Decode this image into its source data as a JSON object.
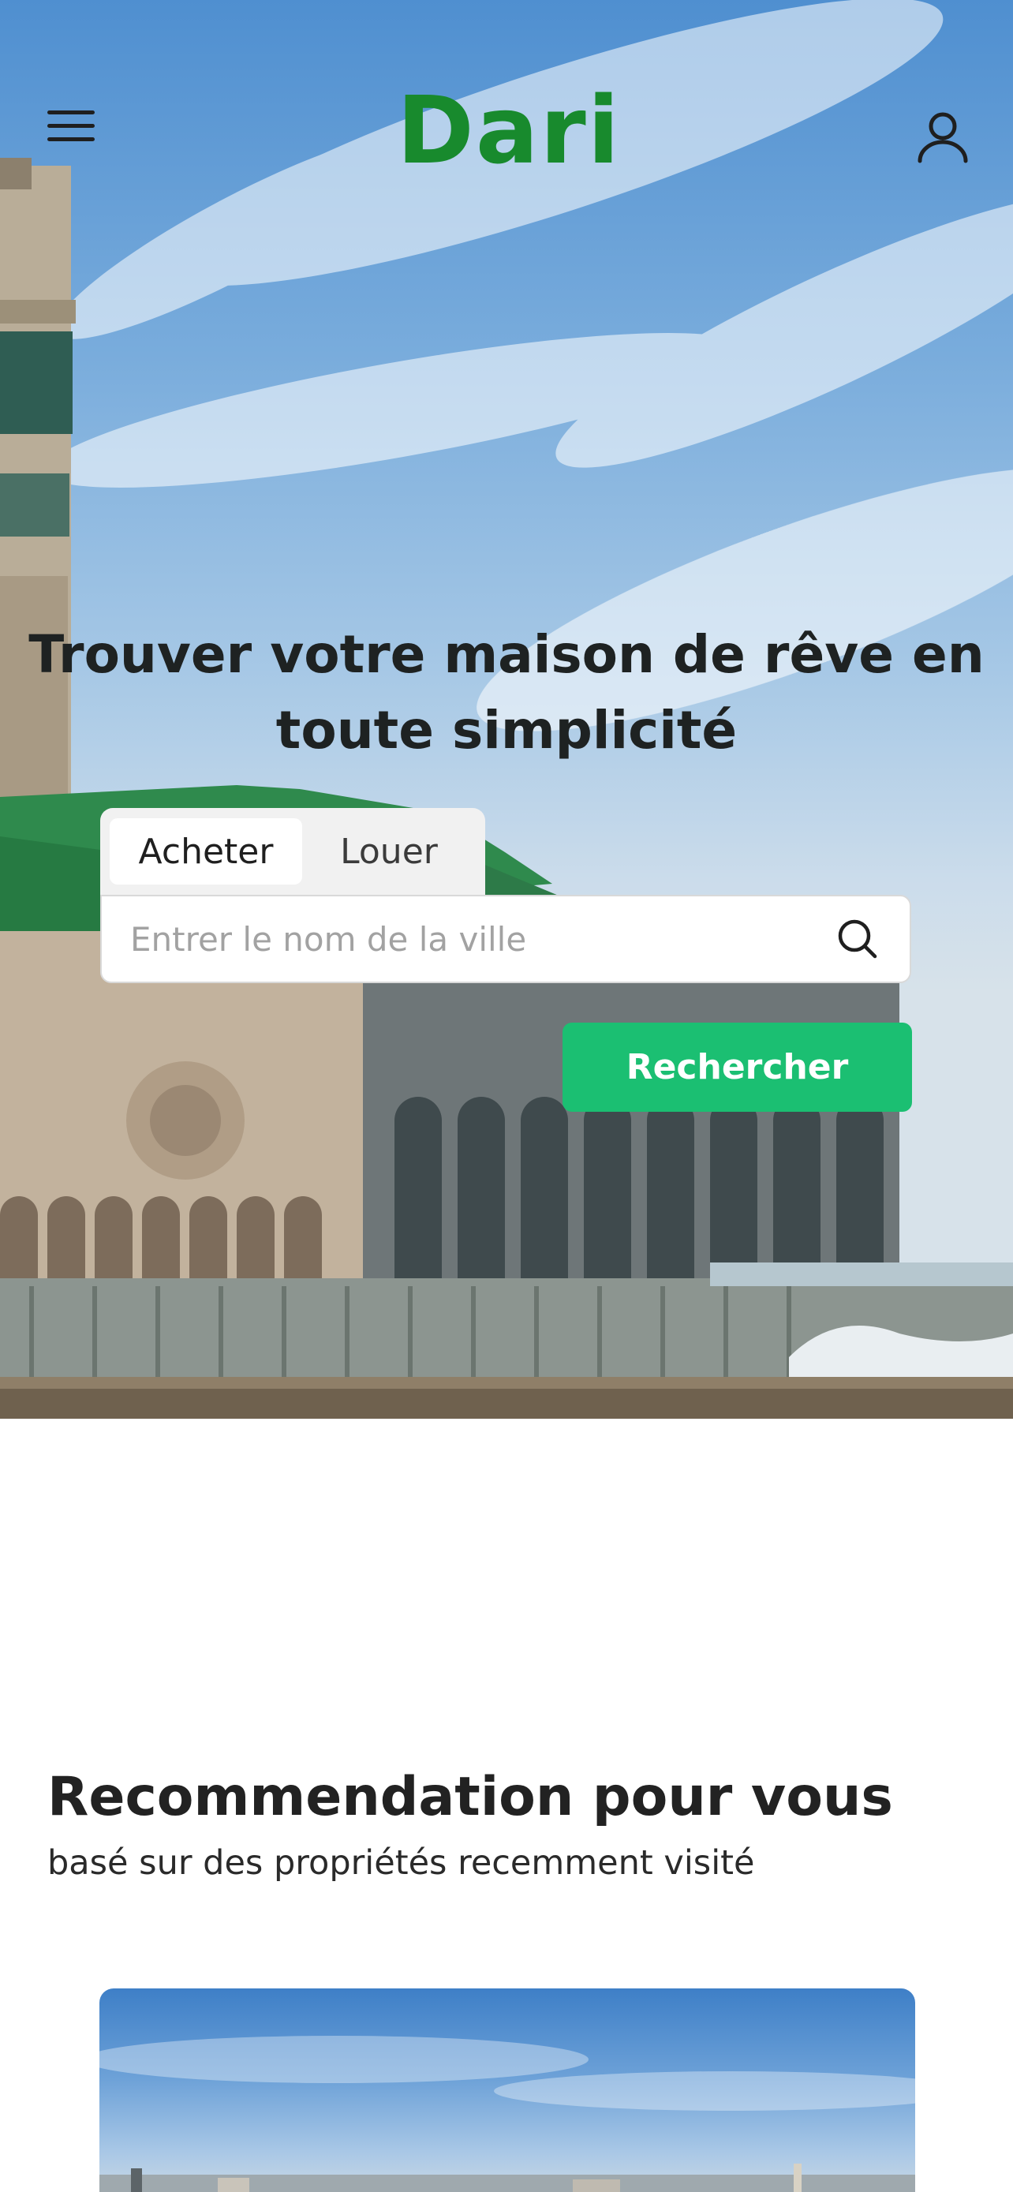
{
  "header": {
    "logo_text": "Dari",
    "menu_icon": "hamburger-menu-icon",
    "user_icon": "user-profile-icon"
  },
  "hero": {
    "title": "Trouver votre maison de rêve en toute simplicité",
    "tabs": [
      {
        "label": "Acheter",
        "active": true
      },
      {
        "label": "Louer",
        "active": false
      }
    ],
    "search": {
      "placeholder": "Entrer le nom de la ville",
      "value": "",
      "icon": "search-icon"
    },
    "search_button": "Rechercher"
  },
  "recommendations": {
    "title": "Recommendation pour vous",
    "subtitle": "basé sur des propriétés recemment visité"
  },
  "colors": {
    "brand": "#188a2d",
    "accent": "#1bbf72"
  }
}
